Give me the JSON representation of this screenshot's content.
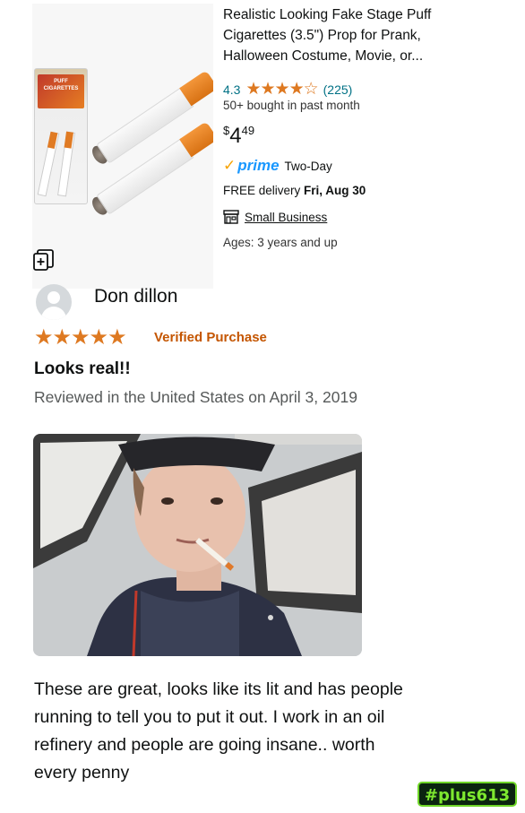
{
  "product": {
    "title_line1": "Realistic Looking Fake Stage Puff",
    "title_line2": "Cigarettes (3.5\") Prop for Prank,",
    "title_line3": "Halloween Costume, Movie, or...",
    "rating_value": "4.3",
    "stars_glyphs": "★★★★☆",
    "rating_count": "(225)",
    "bought": "50+ bought in past month",
    "price_currency": "$",
    "price_dollars": "4",
    "price_cents": "49",
    "prime_check": "✓",
    "prime_label": "prime",
    "prime_days": "Two-Day",
    "delivery_prefix": "FREE delivery",
    "delivery_date": "Fri, Aug 30",
    "small_business": "Small Business",
    "ages": "Ages: 3 years and up",
    "pack_label": "PUFF CIGARETTES"
  },
  "review": {
    "reviewer_name": "Don dillon",
    "stars_glyphs": "★★★★★",
    "verified": "Verified Purchase",
    "title": "Looks real!!",
    "date": "Reviewed in the United States on April 3, 2019",
    "body_line1": "These are great, looks like its lit and has people",
    "body_line2": "running to tell you to put it out. I work in an oil",
    "body_line3": "refinery and people are going insane.. worth",
    "body_line4": "every penny"
  },
  "watermark": "#plus613",
  "colors": {
    "star": "#de7921",
    "link": "#007185",
    "verified": "#c45500",
    "prime": "#1a98ff",
    "watermark": "#7ee82f"
  },
  "icons": [
    "compare-icon",
    "small-business-icon",
    "avatar-icon",
    "star-icon"
  ]
}
